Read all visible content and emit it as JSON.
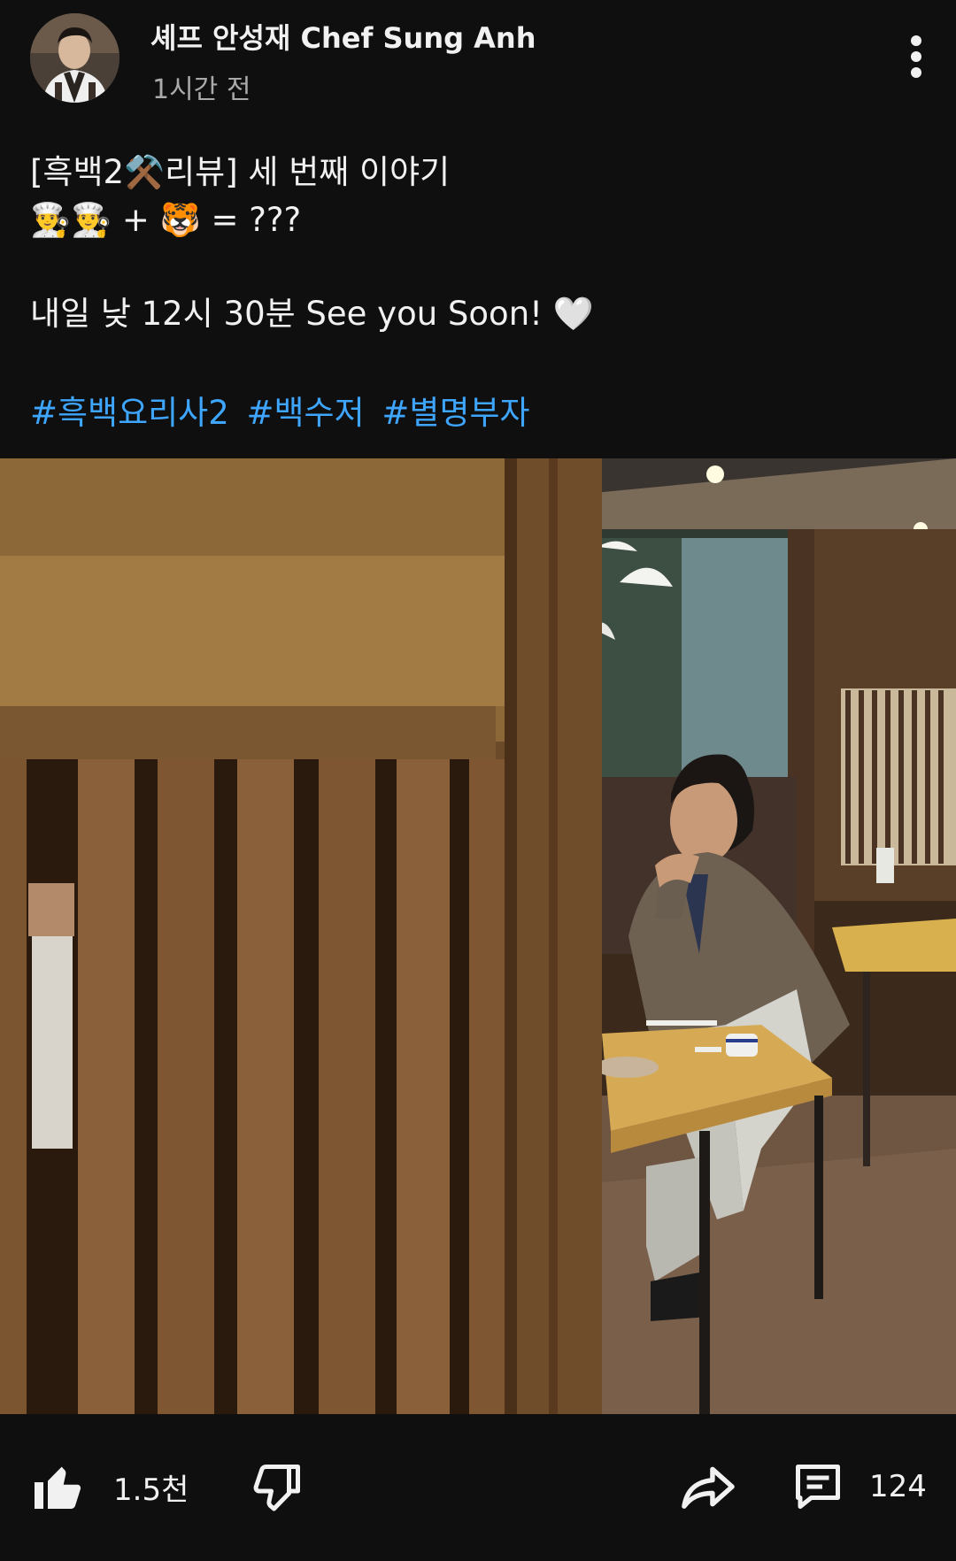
{
  "channel": {
    "name": "셰프 안성재 Chef Sung Anh",
    "time_ago": "1시간 전"
  },
  "post": {
    "line1": "[흑백2⚒️리뷰] 세 번째 이야기",
    "line2": "👨‍🍳👨‍🍳 + 🐯 = ???",
    "line3": "내일 낮 12시 30분 See you Soon! 🤍",
    "hashtags": [
      "#흑백요리사2",
      "#백수저",
      "#별명부자"
    ]
  },
  "actions": {
    "likes": "1.5천",
    "comments": "124"
  },
  "icons": {
    "more": "more-vert-icon",
    "like": "thumbs-up-icon",
    "dislike": "thumbs-down-icon",
    "share": "share-icon",
    "comment": "comment-icon"
  },
  "colors": {
    "background": "#0f0f0f",
    "text": "#f1f1f1",
    "secondary_text": "#aaaaaa",
    "hashtag": "#3ea6ff"
  }
}
